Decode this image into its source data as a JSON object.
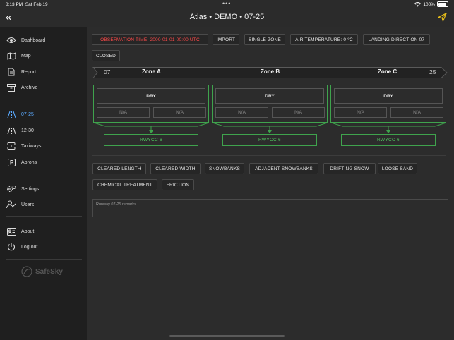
{
  "status": {
    "time": "8:13 PM",
    "date": "Sat Feb 19",
    "battery": "100%"
  },
  "nav": {
    "title": "Atlas • DEMO • 07-25"
  },
  "sidebar": {
    "items": [
      {
        "label": "Dashboard",
        "icon": "eye-icon"
      },
      {
        "label": "Map",
        "icon": "map-icon"
      },
      {
        "label": "Report",
        "icon": "report-icon"
      },
      {
        "label": "Archive",
        "icon": "archive-icon"
      },
      {
        "label": "07-25",
        "icon": "runway-icon",
        "active": true
      },
      {
        "label": "12-30",
        "icon": "runway-icon"
      },
      {
        "label": "Taxiways",
        "icon": "taxiway-icon"
      },
      {
        "label": "Aprons",
        "icon": "parking-icon"
      },
      {
        "label": "Settings",
        "icon": "settings-icon"
      },
      {
        "label": "Users",
        "icon": "users-icon"
      },
      {
        "label": "About",
        "icon": "about-icon"
      },
      {
        "label": "Log out",
        "icon": "logout-icon"
      }
    ],
    "brand": "SafeSky"
  },
  "toolbar": {
    "observation_time": "OBSERVATION TIME: 2000-01-01 00:00 UTC",
    "import": "IMPORT",
    "single_zone": "SINGLE ZONE",
    "air_temperature": "AIR TEMPERATURE: 0 °C",
    "landing_direction": "LANDING DIRECTION 07",
    "closed": "CLOSED"
  },
  "runway": {
    "start": "07",
    "end": "25"
  },
  "zones": [
    {
      "name": "Zone A",
      "condition": "DRY",
      "value1": "N/A",
      "value2": "N/A",
      "rwycc": "RWYCC 6"
    },
    {
      "name": "Zone B",
      "condition": "DRY",
      "value1": "N/A",
      "value2": "N/A",
      "rwycc": "RWYCC 6"
    },
    {
      "name": "Zone C",
      "condition": "DRY",
      "value1": "N/A",
      "value2": "N/A",
      "rwycc": "RWYCC 6"
    }
  ],
  "options": {
    "cleared_length": "CLEARED LENGTH",
    "cleared_width": "CLEARED WIDTH",
    "snowbanks": "SNOWBANKS",
    "adjacent_snowbanks": "ADJACENT SNOWBANKS",
    "drifting_snow": "DRIFTING SNOW",
    "loose_sand": "LOOSE SAND",
    "chemical_treatment": "CHEMICAL TREATMENT",
    "friction": "FRICTION"
  },
  "remarks": {
    "placeholder": "Runway 07-25 remarks"
  },
  "colors": {
    "accent": "#5aa9ff",
    "green": "#3fa34d",
    "alert": "#ff4a4a"
  }
}
